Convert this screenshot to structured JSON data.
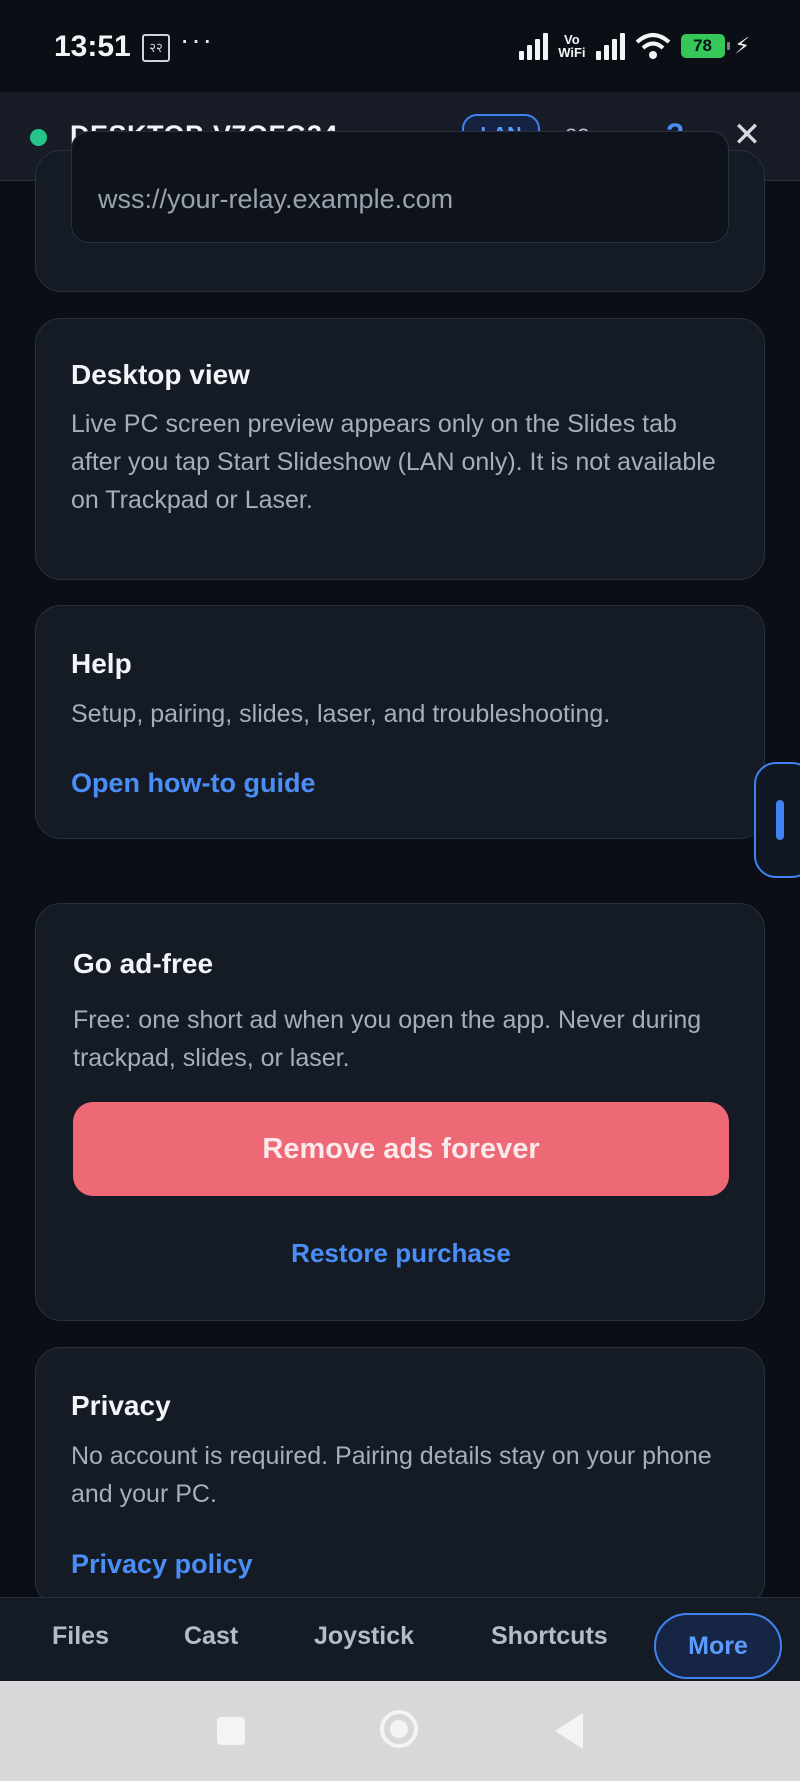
{
  "status_bar": {
    "time": "13:51",
    "notification_icon_text": "२२",
    "more_icon": "···",
    "vowifi_line1": "Vo",
    "vowifi_line2": "WiFi",
    "battery_level": "78"
  },
  "header": {
    "device_name": "DESKTOP-V7QFG34",
    "connection_status_color": "#25c48b",
    "connection_badge": "LAN",
    "latency": "83 ms",
    "help_label": "?",
    "close_label": "✕"
  },
  "relay": {
    "placeholder": "wss://your-relay.example.com"
  },
  "desktop_view": {
    "title": "Desktop view",
    "body": "Live PC screen preview appears only on the Slides tab after you tap Start Slideshow (LAN only). It is not available on Trackpad or Laser."
  },
  "help": {
    "title": "Help",
    "body": "Setup, pairing, slides, laser, and troubleshooting.",
    "link": "Open how-to guide"
  },
  "ad_free": {
    "title": "Go ad-free",
    "body": "Free: one short ad when you open the app. Never during trackpad, slides, or laser.",
    "button": "Remove ads forever",
    "restore": "Restore purchase"
  },
  "privacy": {
    "title": "Privacy",
    "body": "No account is required. Pairing details stay on your phone and your PC.",
    "link": "Privacy policy"
  },
  "bottom_nav": {
    "items": [
      "Files",
      "Cast",
      "Joystick",
      "Shortcuts",
      "More"
    ],
    "active": "More"
  },
  "colors": {
    "accent": "#3f82f0",
    "primary_button": "#ee6976",
    "background": "#0b0f15",
    "card": "#151b25"
  }
}
